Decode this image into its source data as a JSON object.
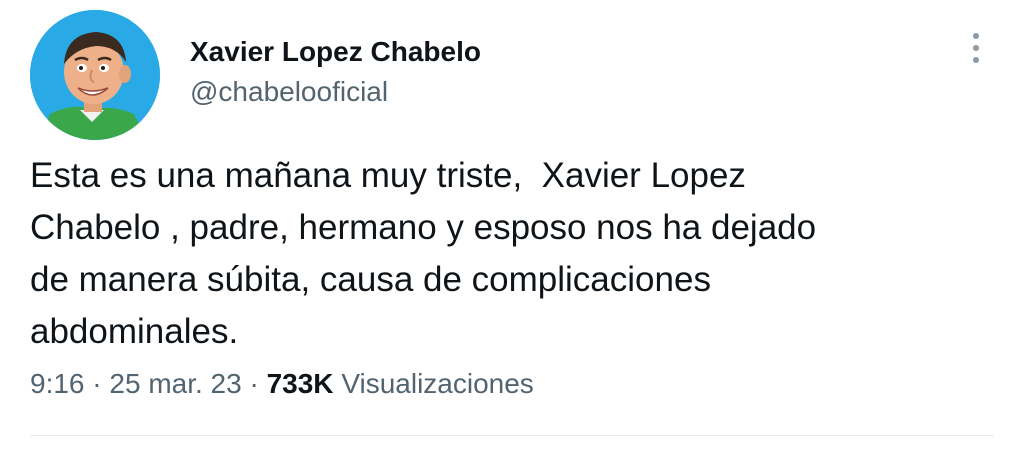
{
  "author": {
    "display_name": "Xavier Lopez Chabelo",
    "handle": "@chabelooficial",
    "avatar_icon": "profile-photo-avatar"
  },
  "tweet": {
    "text": "Esta es una mañana muy triste,  Xavier Lopez\nChabelo , padre, hermano y esposo nos ha dejado\nde manera súbita, causa de complicaciones\nabdominales."
  },
  "meta": {
    "time": "9:16",
    "separator": "·",
    "date": "25 mar. 23",
    "views_count": "733K",
    "views_label": "Visualizaciones"
  },
  "menu": {
    "icon": "more-vertical-icon"
  },
  "colors": {
    "text_primary": "#0f1419",
    "text_secondary": "#536471",
    "avatar_background": "#29a9e6",
    "divider": "#e7e9ea"
  }
}
